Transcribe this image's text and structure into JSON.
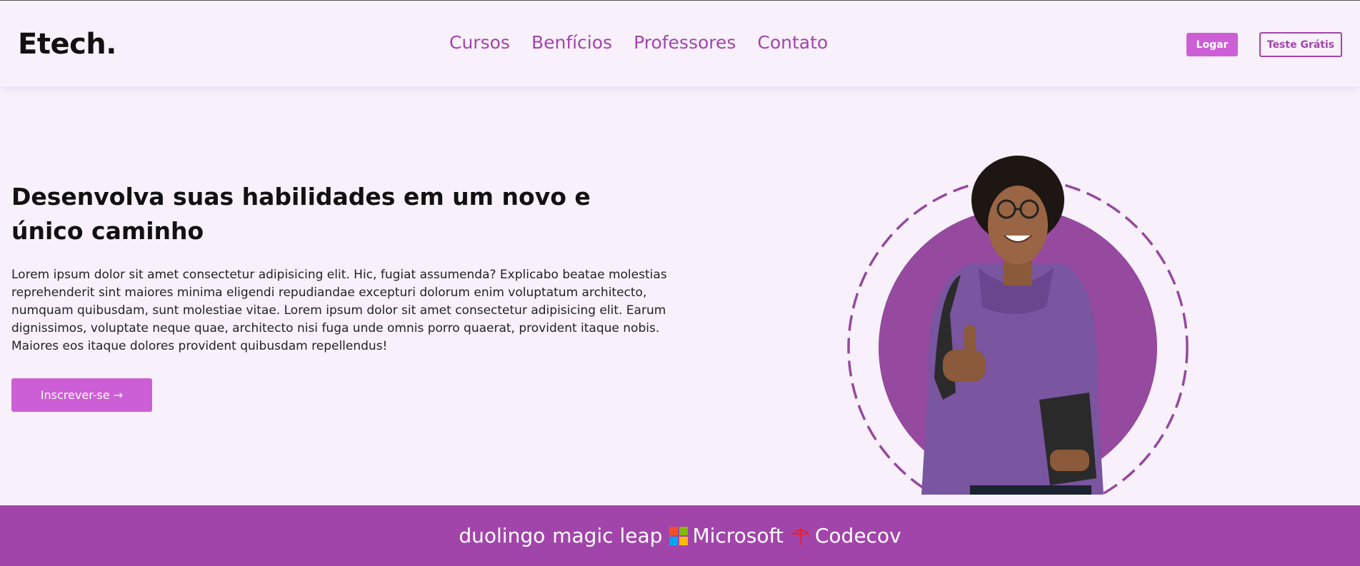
{
  "header": {
    "logo": "Etech.",
    "nav": [
      "Cursos",
      "Benfícios",
      "Professores",
      "Contato"
    ],
    "login_label": "Logar",
    "trial_label": "Teste Grátis"
  },
  "hero": {
    "title": "Desenvolva suas habilidades em um novo e único caminho",
    "text": "Lorem ipsum dolor sit amet consectetur adipisicing elit. Hic, fugiat assumenda? Explicabo beatae molestias reprehenderit sint maiores minima eligendi repudiandae excepturi dolorum enim voluptatum architecto, numquam quibusdam, sunt molestiae vitae. Lorem ipsum dolor sit amet consectetur adipisicing elit. Earum dignissimos, voluptate neque quae, architecto nisi fuga unde omnis porro quaerat, provident itaque nobis. Maiores eos itaque dolores provident quibusdam repellendus!",
    "cta_label": "Inscrever-se →"
  },
  "partners": [
    {
      "name": "duolingo",
      "icon": ""
    },
    {
      "name": "magic leap",
      "icon": ""
    },
    {
      "name": "Microsoft",
      "icon": "microsoft-logo-icon"
    },
    {
      "name": "Codecov",
      "icon": "codecov-umbrella-icon"
    }
  ],
  "colors": {
    "accent": "#a245ab",
    "button": "#cc5fd6",
    "background": "#f8f1fb",
    "hero_circle": "#95499f"
  }
}
